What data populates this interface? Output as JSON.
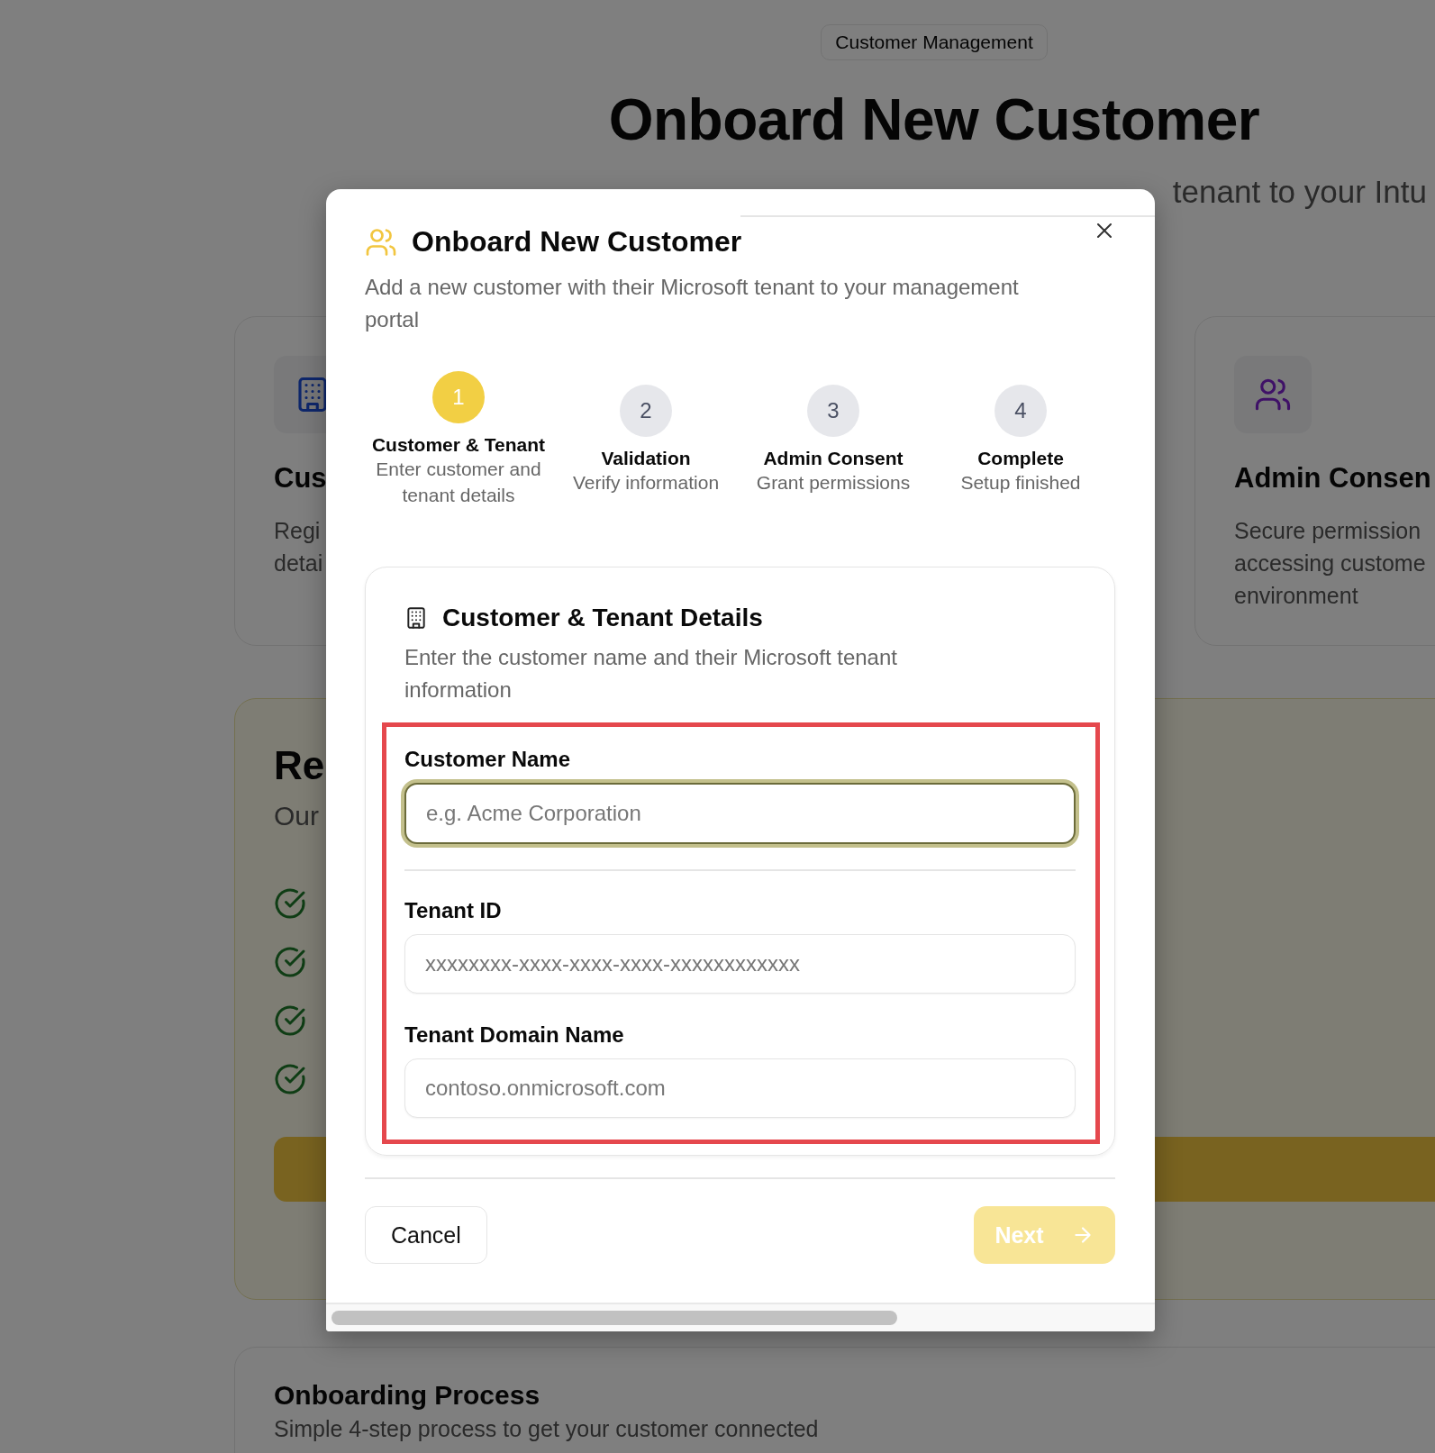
{
  "background": {
    "badge": "Customer Management",
    "title": "Onboard New Customer",
    "subtitle": "tenant to your Intu",
    "feature_cards": [
      {
        "kind": "building",
        "title": "Cus",
        "description": "Regi\ndetai"
      },
      {
        "kind": "users",
        "title": "Admin Consen",
        "description": "Secure permission\naccessing custome\nenvironment"
      }
    ],
    "ready_card": {
      "title": "Re",
      "description": "Our",
      "checklist": [
        {
          "kind": "check"
        },
        {
          "kind": "check"
        },
        {
          "kind": "check"
        },
        {
          "kind": "check"
        }
      ]
    },
    "process_card": {
      "title": "Onboarding Process",
      "description": "Simple 4-step process to get your customer connected"
    }
  },
  "dialog": {
    "title": "Onboard New Customer",
    "description": "Add a new customer with their Microsoft tenant to your management portal",
    "steps": [
      {
        "number": "1",
        "label": "Customer & Tenant",
        "description": "Enter customer and tenant details",
        "selected": true
      },
      {
        "number": "2",
        "label": "Validation",
        "description": "Verify information",
        "selected": false
      },
      {
        "number": "3",
        "label": "Admin Consent",
        "description": "Grant permissions",
        "selected": false
      },
      {
        "number": "4",
        "label": "Complete",
        "description": "Setup finished",
        "selected": false
      }
    ],
    "section": {
      "title": "Customer & Tenant Details",
      "description": "Enter the customer name and their Microsoft tenant information",
      "highlighted": true,
      "fields": [
        {
          "label": "Customer Name",
          "placeholder": "e.g. Acme Corporation",
          "focused": true
        },
        {
          "label": "Tenant ID",
          "placeholder": "xxxxxxxx-xxxx-xxxx-xxxx-xxxxxxxxxxxx",
          "focused": false
        },
        {
          "label": "Tenant Domain Name",
          "placeholder": "contoso.onmicrosoft.com",
          "focused": false
        }
      ]
    },
    "cancel": "Cancel",
    "next": {
      "label": "Next",
      "disabled": true
    }
  }
}
